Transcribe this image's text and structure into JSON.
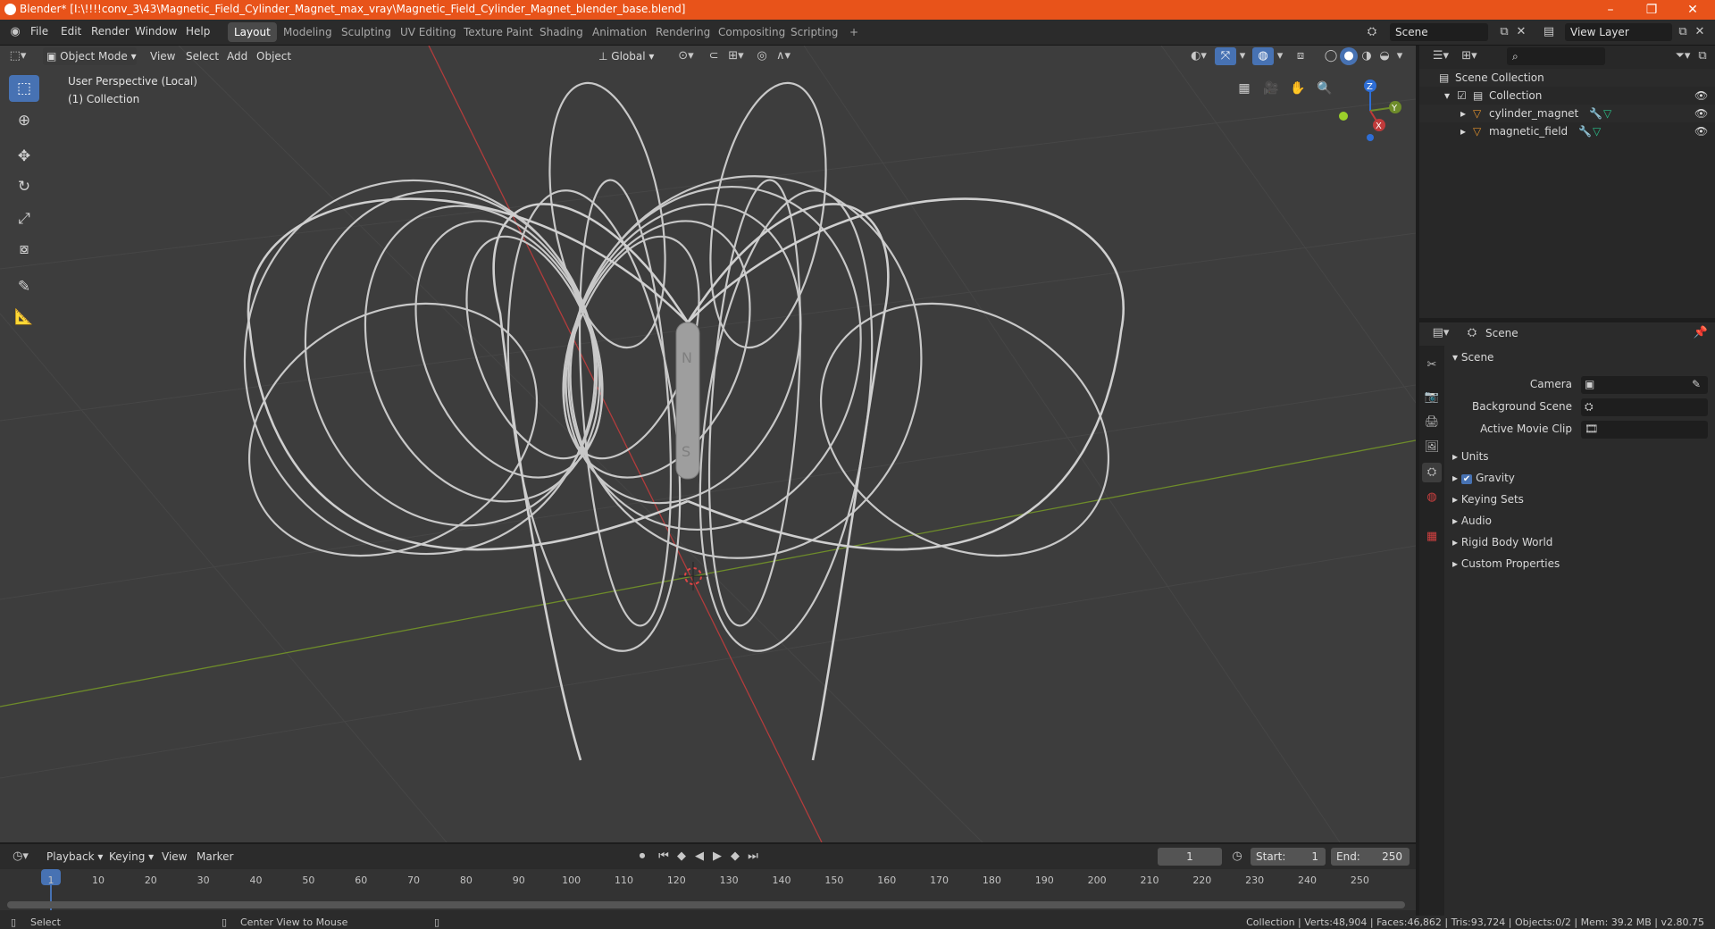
{
  "window": {
    "title": "Blender* [I:\\!!!!conv_3\\43\\Magnetic_Field_Cylinder_Magnet_max_vray\\Magnetic_Field_Cylinder_Magnet_blender_base.blend]",
    "minimize": "–",
    "maximize": "❐",
    "close": "✕"
  },
  "menu": {
    "items": [
      "File",
      "Edit",
      "Render",
      "Window",
      "Help"
    ]
  },
  "workspaces": {
    "tabs": [
      "Layout",
      "Modeling",
      "Sculpting",
      "UV Editing",
      "Texture Paint",
      "Shading",
      "Animation",
      "Rendering",
      "Compositing",
      "Scripting"
    ],
    "active": "Layout",
    "add": "+"
  },
  "scene_selector": {
    "value": "Scene"
  },
  "view_layer_selector": {
    "value": "View Layer"
  },
  "viewport_header": {
    "mode": "Object Mode",
    "menus": [
      "View",
      "Select",
      "Add",
      "Object"
    ],
    "orientation": "Global"
  },
  "viewport": {
    "perspective": "User Perspective (Local)",
    "collection": "(1) Collection",
    "gizmo": {
      "z": "Z",
      "y": "Y",
      "x": "X"
    },
    "magnet_labels": {
      "north": "N",
      "south": "S"
    },
    "colors": {
      "background": "#3d3d3d",
      "x_axis": "#b23c3c",
      "y_axis": "#6e8c2a",
      "field": "#c8c8c8"
    }
  },
  "outliner": {
    "search_placeholder": "",
    "root": "Scene Collection",
    "collection": "Collection",
    "objects": [
      {
        "name": "cylinder_magnet"
      },
      {
        "name": "magnetic_field"
      }
    ]
  },
  "properties": {
    "context": "Scene",
    "panel_title": "Scene",
    "fields": [
      {
        "label": "Camera",
        "value": ""
      },
      {
        "label": "Background Scene",
        "value": ""
      },
      {
        "label": "Active Movie Clip",
        "value": ""
      }
    ],
    "panels": [
      {
        "label": "Units"
      },
      {
        "label": "Gravity",
        "checked": true
      },
      {
        "label": "Keying Sets"
      },
      {
        "label": "Audio"
      },
      {
        "label": "Rigid Body World"
      },
      {
        "label": "Custom Properties"
      }
    ]
  },
  "timeline": {
    "menus": [
      "Playback",
      "Keying",
      "View",
      "Marker"
    ],
    "current_frame": "1",
    "start_label": "Start:",
    "start": "1",
    "end_label": "End:",
    "end": "250",
    "ticks": [
      "1",
      "10",
      "20",
      "30",
      "40",
      "50",
      "60",
      "70",
      "80",
      "90",
      "100",
      "110",
      "120",
      "130",
      "140",
      "150",
      "160",
      "170",
      "180",
      "190",
      "200",
      "210",
      "220",
      "230",
      "240",
      "250"
    ]
  },
  "statusbar": {
    "left": "Select",
    "middle": "Center View to Mouse",
    "right": "Collection | Verts:48,904 | Faces:46,862 | Tris:93,724 | Objects:0/2 | Mem: 39.2 MB | v2.80.75"
  }
}
